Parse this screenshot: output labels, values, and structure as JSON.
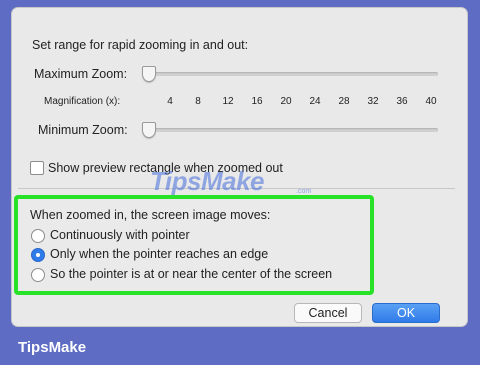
{
  "dialog": {
    "range_header": "Set range for rapid zooming in and out:",
    "max_zoom_label": "Maximum Zoom:",
    "magnification_label": "Magnification (x):",
    "magnification_ticks": [
      "4",
      "8",
      "12",
      "16",
      "20",
      "24",
      "28",
      "32",
      "36",
      "40"
    ],
    "min_zoom_label": "Minimum Zoom:",
    "max_zoom_value_fraction": 0,
    "min_zoom_value_fraction": 0,
    "preview_checkbox_label": "Show preview rectangle when zoomed out",
    "preview_checked": false,
    "move_header": "When zoomed in, the screen image moves:",
    "move_options": [
      {
        "label": "Continuously with pointer",
        "selected": false
      },
      {
        "label": "Only when the pointer reaches an edge",
        "selected": true
      },
      {
        "label": "So the pointer is at or near the center of the screen",
        "selected": false
      }
    ],
    "cancel_label": "Cancel",
    "ok_label": "OK"
  },
  "watermark": {
    "text": "TipsMake",
    "sub": ".com"
  },
  "footer": {
    "brand": "TipsMake"
  },
  "colors": {
    "highlight": "#27e227",
    "accent": "#2e7bea",
    "background": "#5e6cc4"
  }
}
